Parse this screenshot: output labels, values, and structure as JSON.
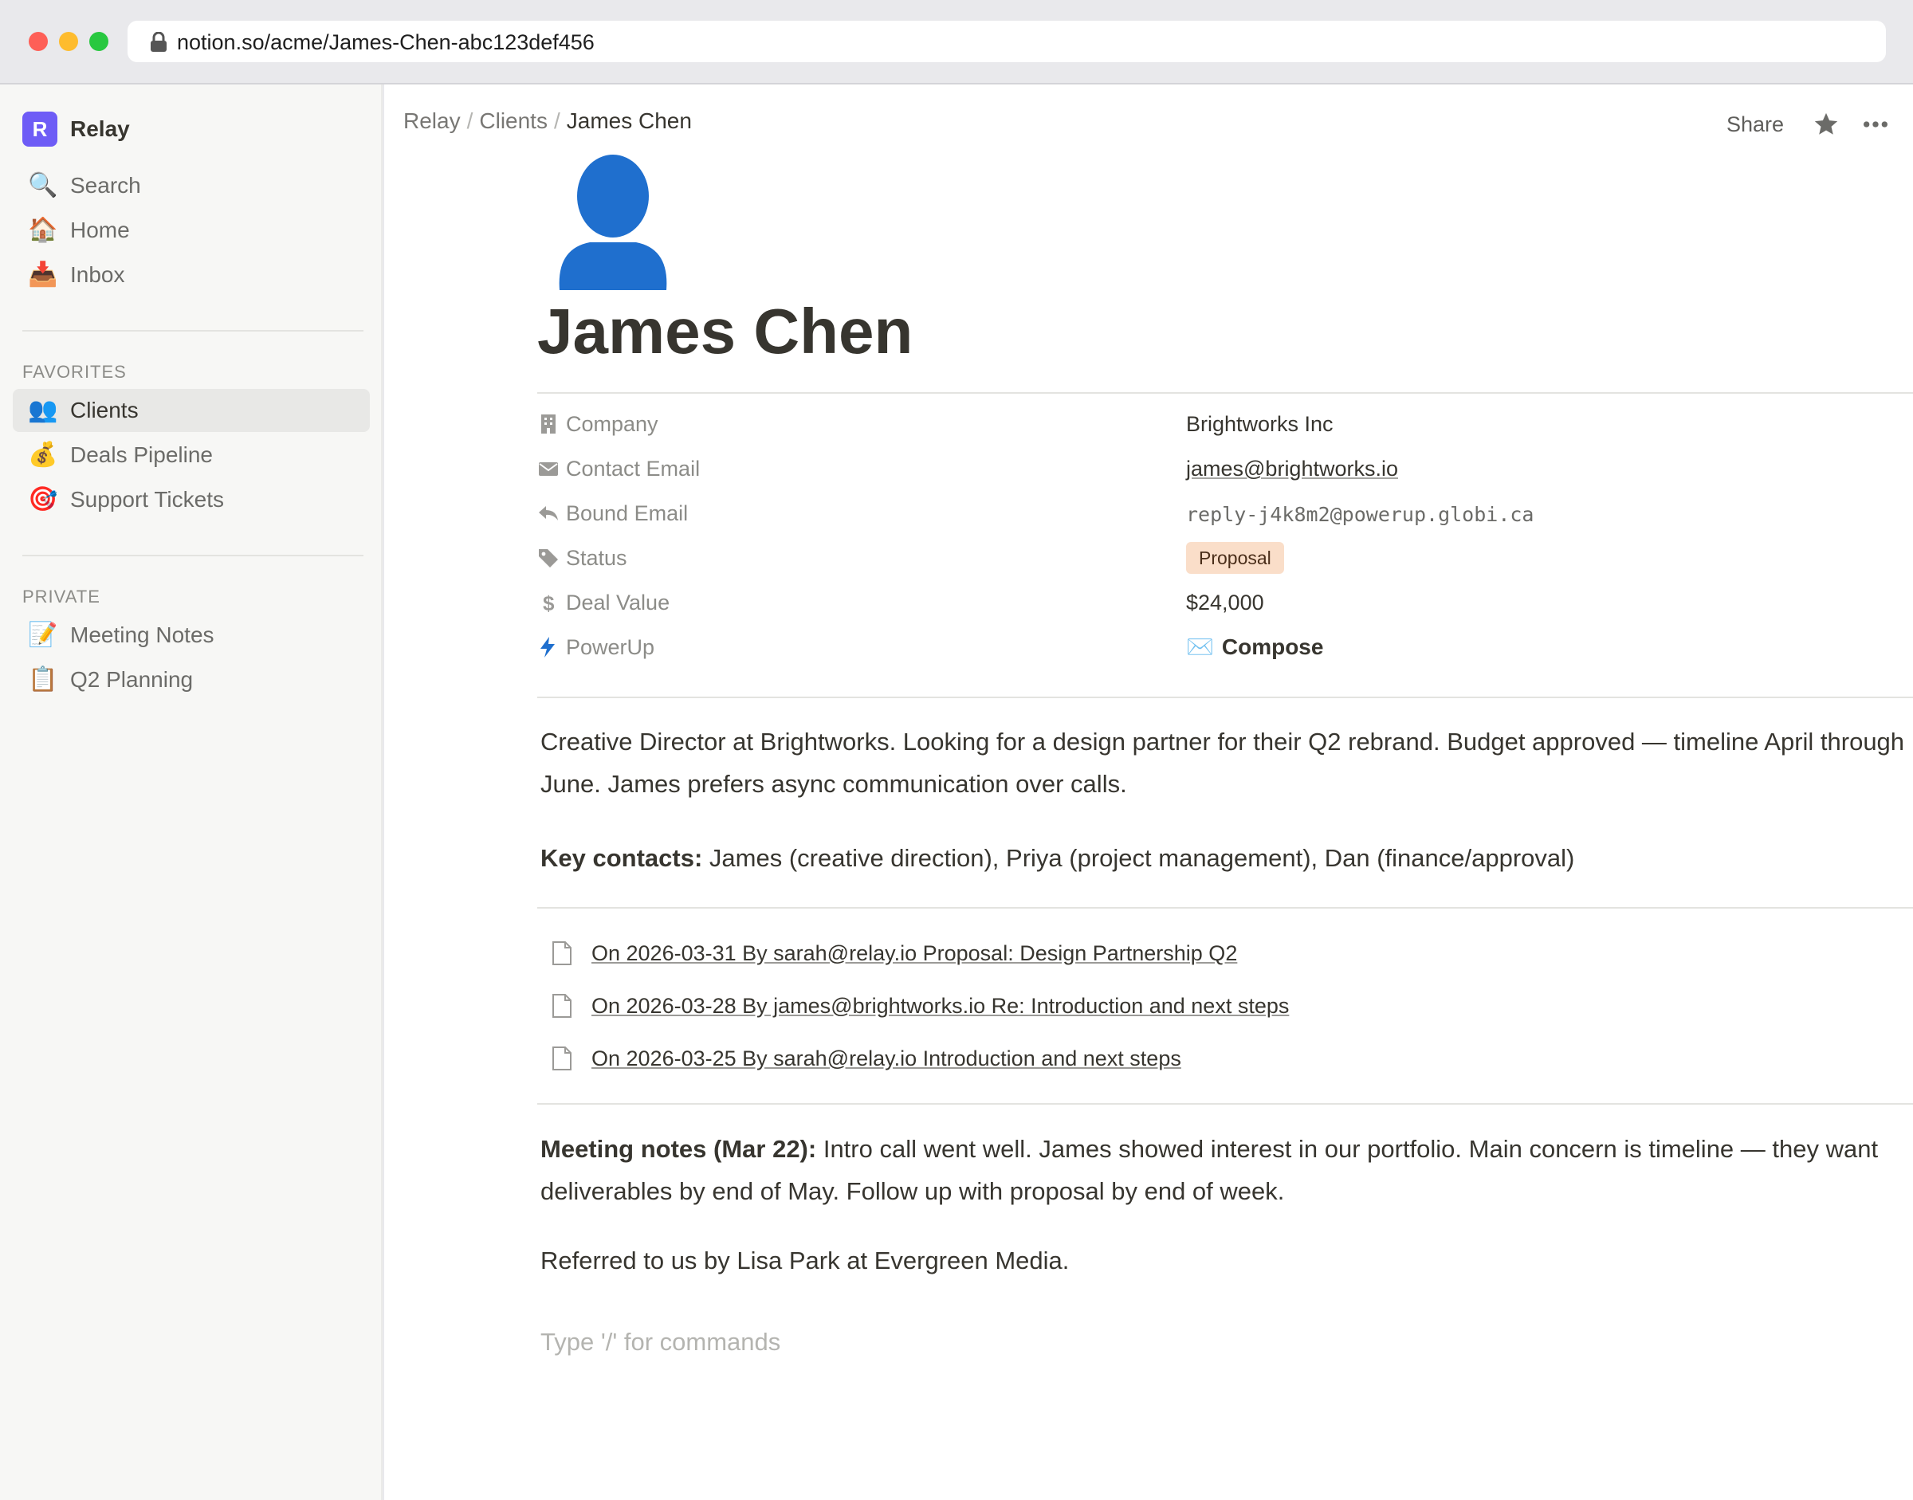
{
  "browser": {
    "url": "notion.so/acme/James-Chen-abc123def456"
  },
  "sidebar": {
    "workspace_initial": "R",
    "workspace_name": "Relay",
    "top_items": [
      {
        "icon": "🔍",
        "label": "Search"
      },
      {
        "icon": "🏠",
        "label": "Home"
      },
      {
        "icon": "📥",
        "label": "Inbox"
      }
    ],
    "favorites_label": "FAVORITES",
    "favorites": [
      {
        "icon": "👥",
        "label": "Clients",
        "active": true
      },
      {
        "icon": "💰",
        "label": "Deals Pipeline"
      },
      {
        "icon": "🎯",
        "label": "Support Tickets"
      }
    ],
    "private_label": "PRIVATE",
    "private": [
      {
        "icon": "📝",
        "label": "Meeting Notes"
      },
      {
        "icon": "📋",
        "label": "Q2 Planning"
      }
    ]
  },
  "topbar": {
    "breadcrumb": [
      "Relay",
      "Clients",
      "James Chen"
    ],
    "separator": "/",
    "share_label": "Share"
  },
  "page": {
    "icon": "person-silhouette",
    "title": "James Chen",
    "properties": {
      "company": {
        "name": "Company",
        "value": "Brightworks Inc"
      },
      "contact_email": {
        "name": "Contact Email",
        "value": "james@brightworks.io"
      },
      "bound_email": {
        "name": "Bound Email",
        "value": "reply-j4k8m2@powerup.globi.ca"
      },
      "status": {
        "name": "Status",
        "value": "Proposal",
        "color": "#fadec9"
      },
      "deal_value": {
        "name": "Deal Value",
        "value": "$24,000"
      },
      "powerup": {
        "name": "PowerUp",
        "icon": "✉️",
        "value": "Compose"
      }
    },
    "body": {
      "intro_line1": "Creative Director at Brightworks. Looking for a design partner for their Q2 rebrand. Budget approved — timeline April through",
      "intro_line2": "June. James prefers async communication over calls.",
      "key_contacts_label": "Key contacts:",
      "key_contacts_text": " James (creative direction), Priya (project management), Dan (finance/approval)",
      "emails": [
        "On 2026-03-31 By sarah@relay.io Proposal: Design Partnership Q2",
        "On 2026-03-28 By james@brightworks.io Re: Introduction and next steps",
        "On 2026-03-25 By sarah@relay.io Introduction and next steps"
      ],
      "meeting_label": "Meeting notes (Mar 22):",
      "meeting_line1": " Intro call went well. James showed interest in our portfolio. Main concern is timeline — they want",
      "meeting_line2": "deliverables by end of May. Follow up with proposal by end of week.",
      "referral": "Referred to us by Lisa Park at Evergreen Media.",
      "placeholder": "Type '/' for commands"
    }
  },
  "colors": {
    "accent": "#6e5cf6",
    "icon_blue": "#1f6fce",
    "text": "#37352f",
    "muted": "#8c8c88"
  }
}
